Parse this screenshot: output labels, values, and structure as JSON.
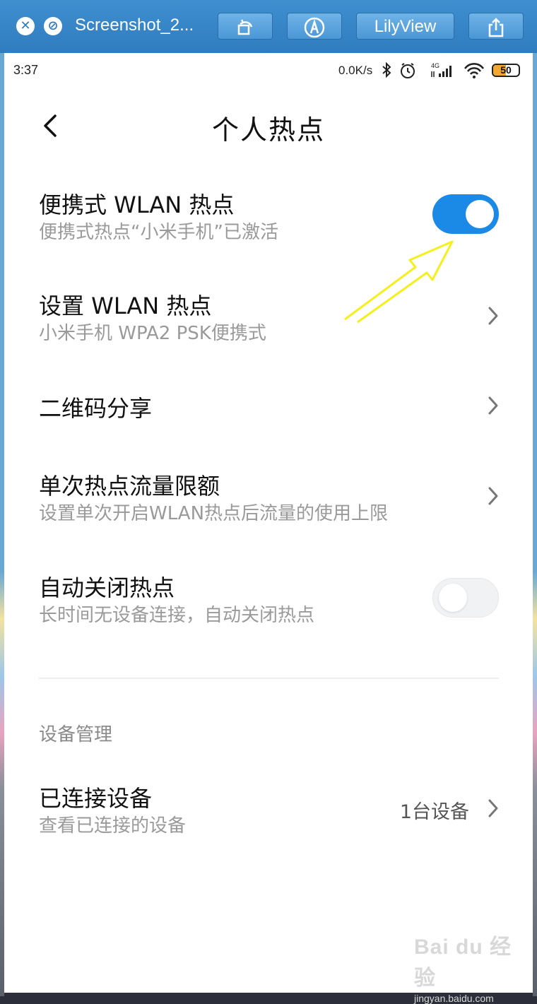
{
  "viewer": {
    "title": "Screenshot_2...",
    "lily_button": "LilyView",
    "icons": [
      "close-icon",
      "cancel-icon",
      "rotate-icon",
      "markup-icon",
      "share-icon"
    ]
  },
  "status_bar": {
    "time": "3:37",
    "speed": "0.0K/s",
    "network": "4G",
    "battery": "50",
    "battery_level_percent": 50,
    "icons": [
      "bluetooth-icon",
      "alarm-icon",
      "signal-icon",
      "wifi-icon",
      "battery-icon"
    ]
  },
  "header": {
    "title": "个人热点",
    "back_icon": "chevron-left-icon"
  },
  "settings": {
    "portable_hotspot": {
      "title": "便携式 WLAN 热点",
      "subtitle": "便携式热点“小米手机”已激活",
      "enabled": true
    },
    "configure_hotspot": {
      "title": "设置 WLAN 热点",
      "subtitle": "小米手机 WPA2 PSK便携式"
    },
    "qr_share": {
      "title": "二维码分享"
    },
    "data_limit": {
      "title": "单次热点流量限额",
      "subtitle": "设置单次开启WLAN热点后流量的使用上限"
    },
    "auto_off": {
      "title": "自动关闭热点",
      "subtitle": "长时间无设备连接，自动关闭热点",
      "enabled": false
    }
  },
  "device_management": {
    "section_title": "设备管理",
    "connected": {
      "title": "已连接设备",
      "subtitle": "查看已连接的设备",
      "value": "1台设备"
    }
  },
  "colors": {
    "toolbar": "#3f8fcf",
    "toggle_on": "#1a8ae6",
    "annotation": "#f5ef1a"
  },
  "watermark": {
    "main": "Bai du 经验",
    "sub": "jingyan.baidu.com"
  }
}
